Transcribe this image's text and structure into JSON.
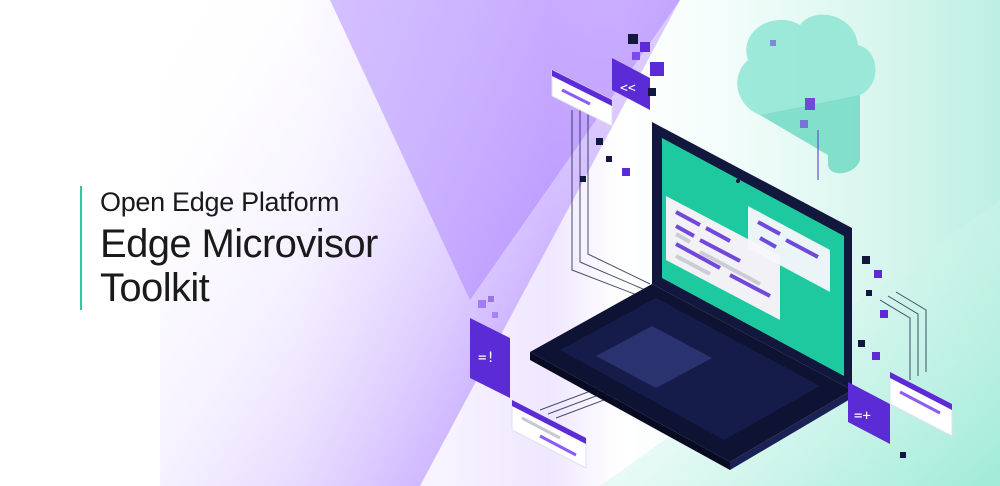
{
  "banner": {
    "subtitle": "Open Edge Platform",
    "title_line1": "Edge Microvisor",
    "title_line2": "Toolkit"
  },
  "illustration": {
    "tile_glyph_top": "<<",
    "tile_glyph_left": "=!",
    "tile_glyph_right": "=+"
  },
  "colors": {
    "accent_teal": "#2fc6a6",
    "violet": "#8b5cf6",
    "indigo": "#5b2bd6",
    "navy": "#12173d",
    "screen_green": "#1fc9a0"
  }
}
